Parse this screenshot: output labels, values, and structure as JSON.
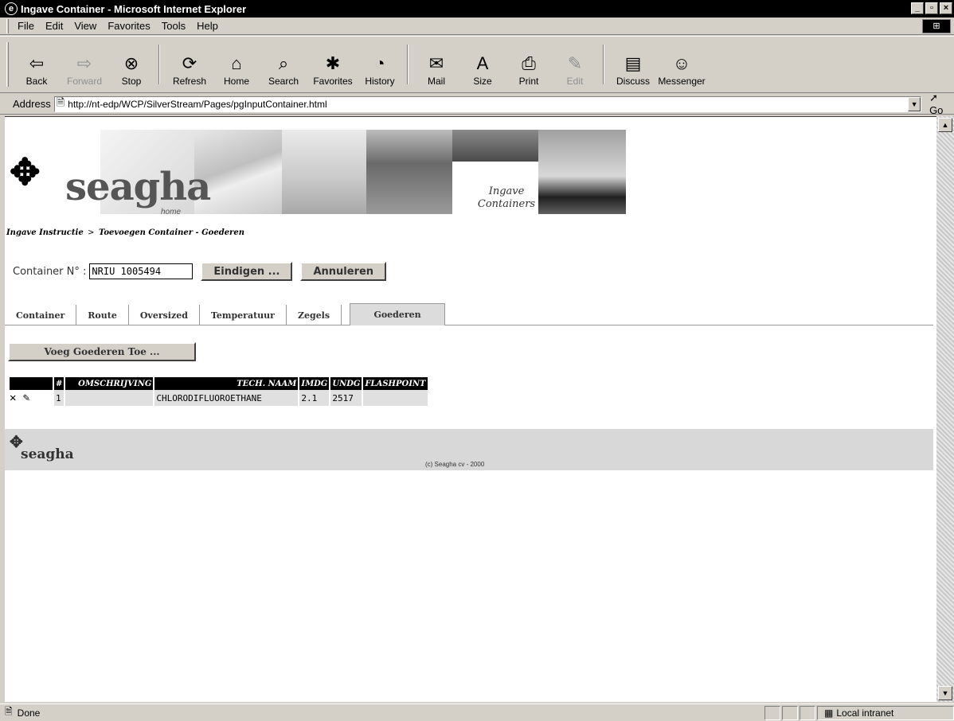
{
  "window": {
    "title": "Ingave Container - Microsoft Internet Explorer",
    "controls": [
      "_",
      "▫",
      "×"
    ]
  },
  "menu": [
    "File",
    "Edit",
    "View",
    "Favorites",
    "Tools",
    "Help"
  ],
  "toolbar": [
    {
      "label": "Back",
      "icon": "⇦",
      "disabled": false
    },
    {
      "label": "Forward",
      "icon": "⇨",
      "disabled": true
    },
    {
      "label": "Stop",
      "icon": "⊗",
      "disabled": false
    },
    {
      "label": "Refresh",
      "icon": "⟳",
      "disabled": false
    },
    {
      "label": "Home",
      "icon": "⌂",
      "disabled": false
    },
    {
      "label": "Search",
      "icon": "⌕",
      "disabled": false
    },
    {
      "label": "Favorites",
      "icon": "✱",
      "disabled": false
    },
    {
      "label": "History",
      "icon": "◔",
      "disabled": false
    },
    {
      "label": "Mail",
      "icon": "✉",
      "disabled": false
    },
    {
      "label": "Size",
      "icon": "A",
      "disabled": false
    },
    {
      "label": "Print",
      "icon": "⎙",
      "disabled": false
    },
    {
      "label": "Edit",
      "icon": "✎",
      "disabled": true
    },
    {
      "label": "Discuss",
      "icon": "▤",
      "disabled": false
    },
    {
      "label": "Messenger",
      "icon": "☺",
      "disabled": false
    }
  ],
  "address": {
    "label": "Address",
    "url": "http://nt-edp/WCP/SilverStream/Pages/pgInputContainer.html",
    "go": "Go"
  },
  "banner": {
    "logo_text": "seagha",
    "logo_sub": "home",
    "section_title_line1": "Ingave",
    "section_title_line2": "Containers"
  },
  "breadcrumb": {
    "root": "Ingave Instructie",
    "sep": ">",
    "current": "Toevoegen Container - Goederen"
  },
  "container": {
    "label": "Container N° :",
    "value": "NRIU 1005494",
    "finish_button": "Eindigen ...",
    "cancel_button": "Annuleren"
  },
  "tabs": [
    "Container",
    "Route",
    "Oversized",
    "Temperatuur",
    "Zegels",
    "Goederen"
  ],
  "active_tab": "Goederen",
  "add_goods_button": "Voeg Goederen Toe ...",
  "goods_table": {
    "headers": [
      "",
      "#",
      "OMSCHRIJVING",
      "TECH. NAAM",
      "IMDG",
      "UNDG",
      "FLASHPOINT"
    ],
    "rows": [
      {
        "num": "1",
        "omschrijving": "",
        "tech_naam": "CHLORODIFLUOROETHANE",
        "imdg": "2.1",
        "undg": "2517",
        "flashpoint": ""
      }
    ]
  },
  "footer": {
    "logo_text": "seagha",
    "copyright": "(c) Seagha cv - 2000"
  },
  "status": {
    "text": "Done",
    "zone": "Local intranet"
  }
}
